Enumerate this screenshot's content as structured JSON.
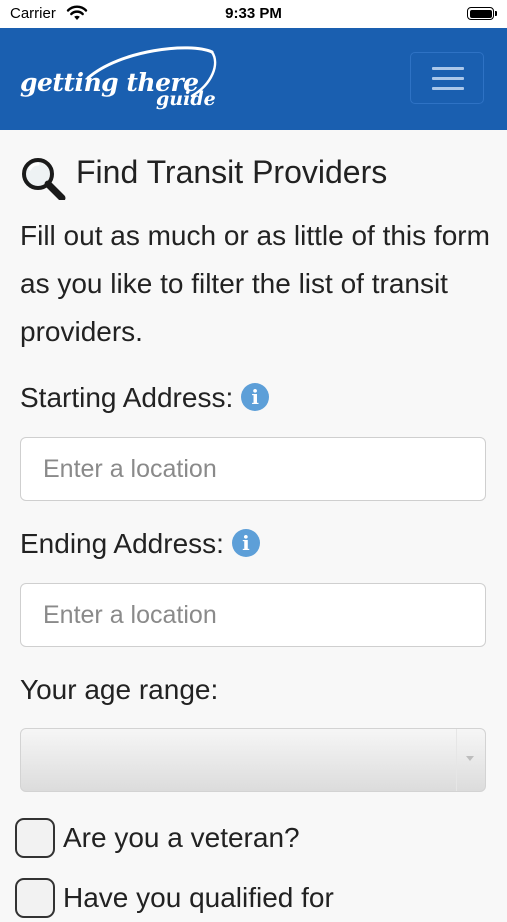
{
  "status_bar": {
    "carrier": "Carrier",
    "time": "9:33 PM"
  },
  "header": {
    "logo_line1": "getting there",
    "logo_line2": "guide",
    "brand_color": "#1a5fb0",
    "menu_icon": "hamburger-menu-icon"
  },
  "page": {
    "title": "Find Transit Providers",
    "title_icon": "magnifier-icon",
    "intro": "Fill out as much or as little of this form as you like to filter the list of transit providers."
  },
  "form": {
    "start": {
      "label": "Starting Address:",
      "placeholder": "Enter a location",
      "value": ""
    },
    "end": {
      "label": "Ending Address:",
      "placeholder": "Enter a location",
      "value": ""
    },
    "age": {
      "label": "Your age range:",
      "selected": ""
    },
    "veteran": {
      "label": "Are you a veteran?",
      "checked": false
    },
    "qualified": {
      "label": "Have you qualified for",
      "checked": false
    },
    "info_icon": "info-icon",
    "info_color": "#5d9fd8"
  }
}
